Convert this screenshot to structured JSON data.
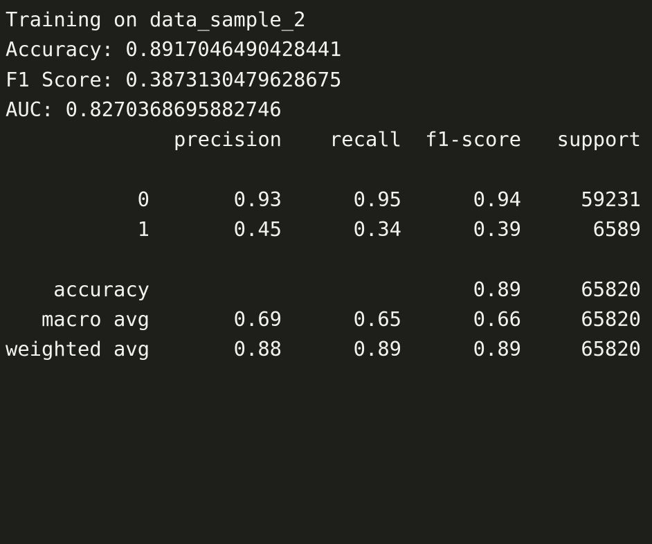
{
  "terminal": {
    "log_lines": [
      "Training on data_sample_2",
      "Accuracy: 0.8917046490428441",
      "F1 Score: 0.3873130479628675",
      "AUC: 0.8270368695882746"
    ],
    "report": {
      "headers": [
        "",
        "precision",
        "recall",
        "f1-score",
        "support"
      ],
      "class_rows": [
        [
          "0",
          "0.93",
          "0.95",
          "0.94",
          "59231"
        ],
        [
          "1",
          "0.45",
          "0.34",
          "0.39",
          "6589"
        ]
      ],
      "summary_rows": [
        [
          "accuracy",
          "",
          "",
          "0.89",
          "65820"
        ],
        [
          "macro avg",
          "0.69",
          "0.65",
          "0.66",
          "65820"
        ],
        [
          "weighted avg",
          "0.88",
          "0.89",
          "0.89",
          "65820"
        ]
      ]
    }
  },
  "colors": {
    "background": "#1e1e1b",
    "foreground": "#f2f2ee"
  }
}
